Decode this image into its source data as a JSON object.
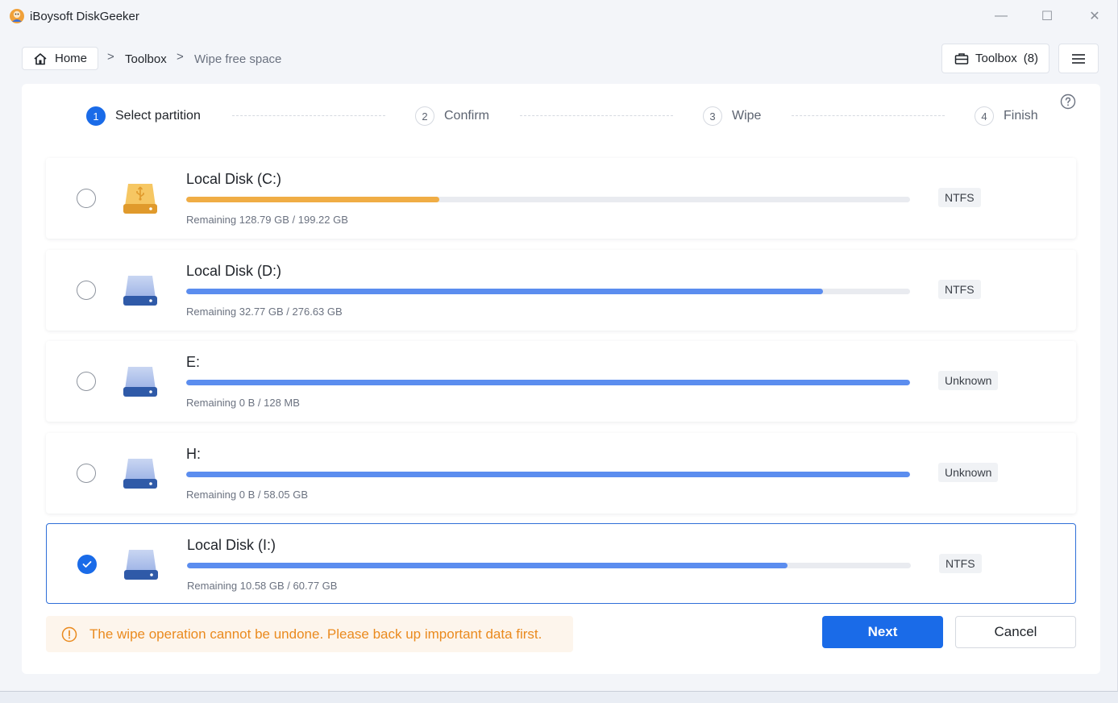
{
  "window": {
    "title": "iBoysoft DiskGeeker",
    "minimize_glyph": "—",
    "maximize_glyph": "☐",
    "close_glyph": "✕"
  },
  "breadcrumb": {
    "home": "Home",
    "sep": ">",
    "toolbox": "Toolbox",
    "current": "Wipe free space"
  },
  "toolbox_button": {
    "label": "Toolbox",
    "count": "(8)"
  },
  "steps": [
    {
      "num": "1",
      "label": "Select partition"
    },
    {
      "num": "2",
      "label": "Confirm"
    },
    {
      "num": "3",
      "label": "Wipe"
    },
    {
      "num": "4",
      "label": "Finish"
    }
  ],
  "partitions": [
    {
      "name": "Local Disk (C:)",
      "remaining": "Remaining 128.79 GB / 199.22 GB",
      "fs": "NTFS",
      "used_fraction": 0.35,
      "bar_color": "#f0ad45",
      "icon": "usb-drive-icon",
      "selected": false
    },
    {
      "name": "Local Disk (D:)",
      "remaining": "Remaining 32.77 GB / 276.63 GB",
      "fs": "NTFS",
      "used_fraction": 0.88,
      "bar_color": "#5b8def",
      "icon": "hard-drive-icon",
      "selected": false
    },
    {
      "name": "E:",
      "remaining": "Remaining 0 B / 128 MB",
      "fs": "Unknown",
      "used_fraction": 1.0,
      "bar_color": "#5b8def",
      "icon": "hard-drive-icon",
      "selected": false
    },
    {
      "name": "H:",
      "remaining": "Remaining 0 B / 58.05 GB",
      "fs": "Unknown",
      "used_fraction": 1.0,
      "bar_color": "#5b8def",
      "icon": "hard-drive-icon",
      "selected": false
    },
    {
      "name": "Local Disk (I:)",
      "remaining": "Remaining 10.58 GB / 60.77 GB",
      "fs": "NTFS",
      "used_fraction": 0.83,
      "bar_color": "#5b8def",
      "icon": "hard-drive-icon",
      "selected": true
    }
  ],
  "warning": {
    "text": "The wipe operation cannot be undone. Please back up important data first.",
    "color": "#ea8a1e"
  },
  "buttons": {
    "next": "Next",
    "cancel": "Cancel"
  },
  "colors": {
    "accent": "#1a6be8",
    "warning_bg": "#fdf5ec"
  }
}
